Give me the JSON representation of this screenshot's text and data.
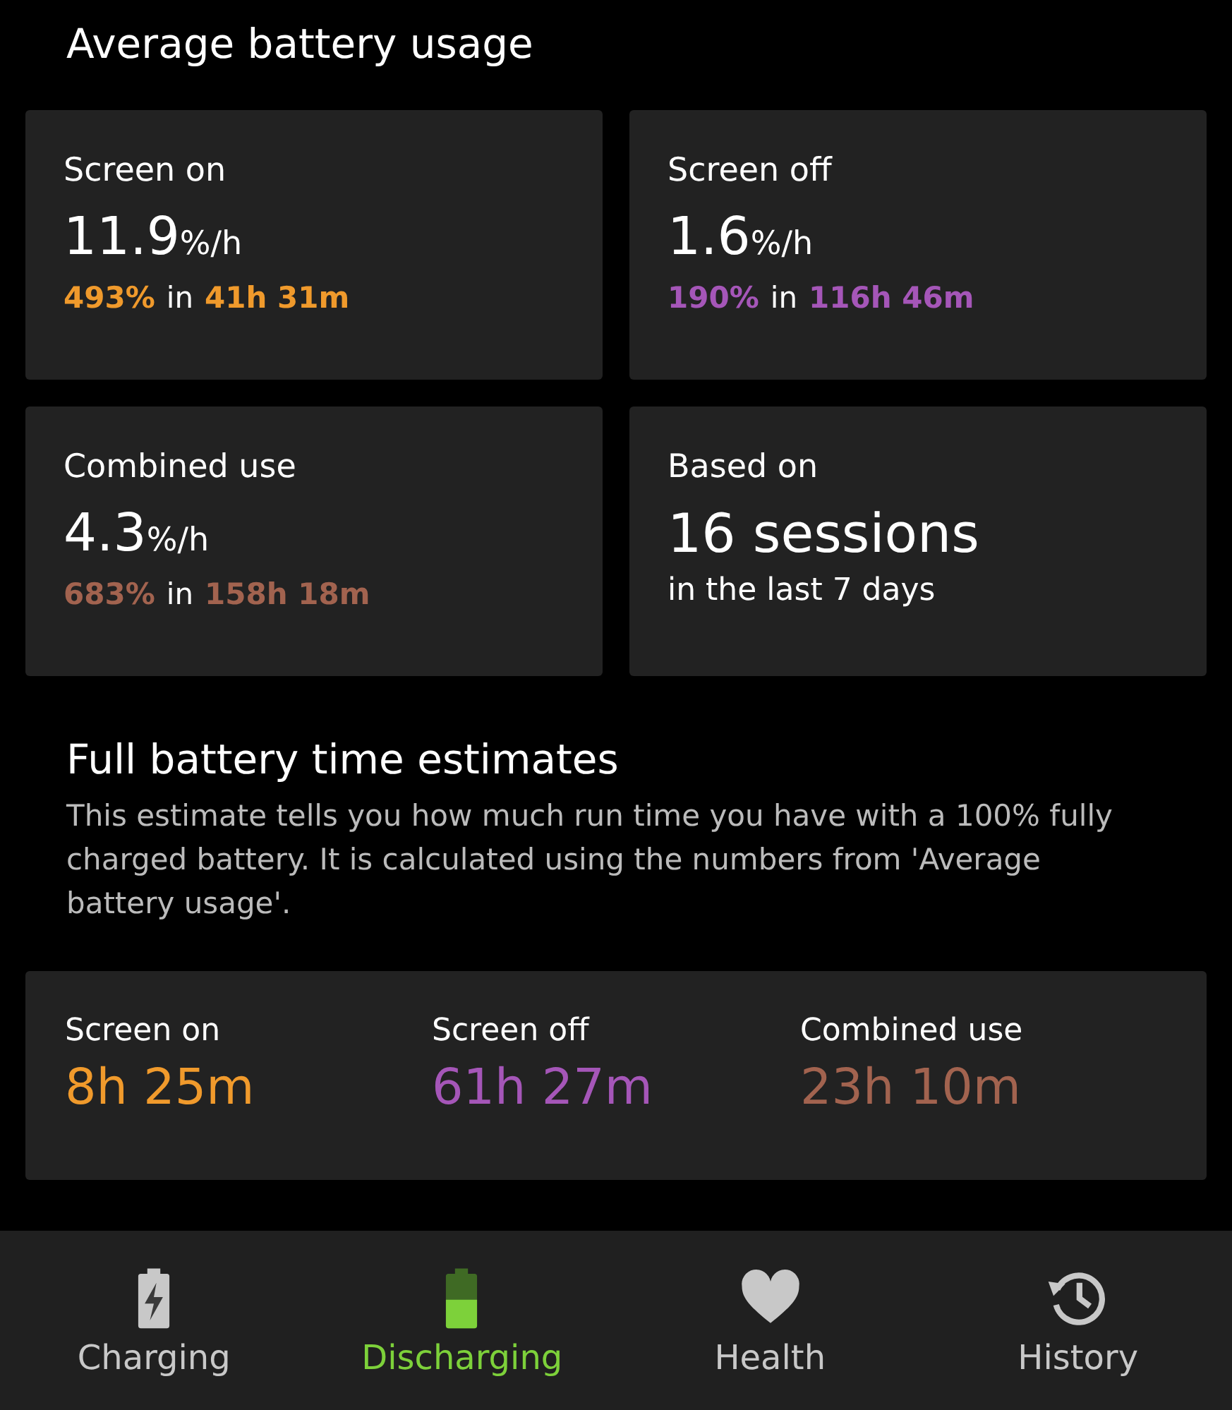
{
  "title": "Average battery usage",
  "cards": [
    {
      "kind": "rate",
      "label": "Screen on",
      "value": "11.9",
      "unit": "%/h",
      "percent": "493%",
      "joiner": "in",
      "duration": "41h 31m",
      "color": "#f09a2c"
    },
    {
      "kind": "rate",
      "label": "Screen off",
      "value": "1.6",
      "unit": "%/h",
      "percent": "190%",
      "joiner": "in",
      "duration": "116h 46m",
      "color": "#a556b8"
    },
    {
      "kind": "rate",
      "label": "Combined use",
      "value": "4.3",
      "unit": "%/h",
      "percent": "683%",
      "joiner": "in",
      "duration": "158h 18m",
      "color": "#a2634f"
    },
    {
      "kind": "sessions",
      "label": "Based on",
      "value": "16 sessions",
      "detail": "in the last 7 days"
    }
  ],
  "estimates": {
    "title": "Full battery time estimates",
    "description": "This estimate tells you how much run time you have with a 100% fully charged battery. It is calculated using the numbers from 'Average battery usage'.",
    "items": [
      {
        "label": "Screen on",
        "value": "8h 25m",
        "color": "#f09a2c"
      },
      {
        "label": "Screen off",
        "value": "61h 27m",
        "color": "#a556b8"
      },
      {
        "label": "Combined use",
        "value": "23h 10m",
        "color": "#a2634f"
      }
    ]
  },
  "nav": [
    {
      "kind": "charging",
      "label": "Charging",
      "selected": false
    },
    {
      "kind": "discharging",
      "label": "Discharging",
      "selected": true
    },
    {
      "kind": "health",
      "label": "Health",
      "selected": false
    },
    {
      "kind": "history",
      "label": "History",
      "selected": false
    }
  ]
}
